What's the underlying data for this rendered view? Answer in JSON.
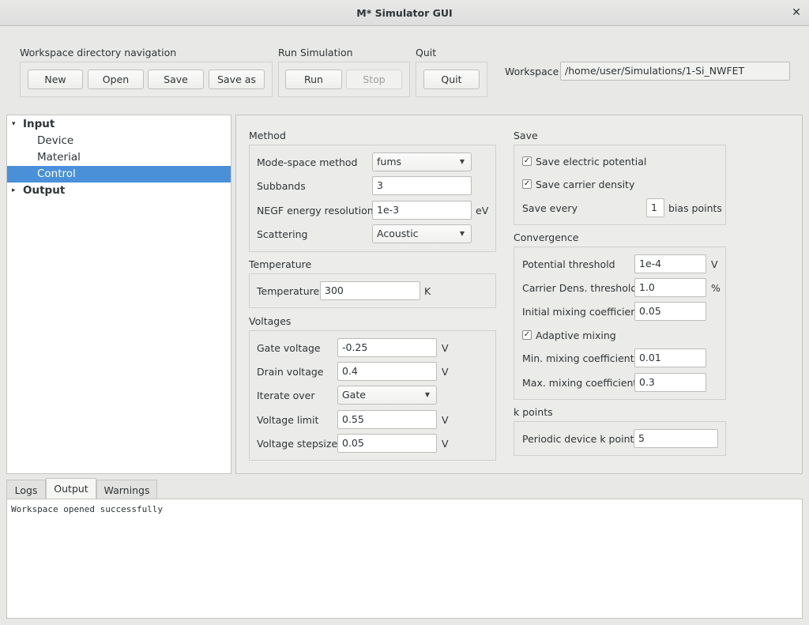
{
  "window": {
    "title": "M* Simulator GUI",
    "close_glyph": "✕"
  },
  "toolbar": {
    "workspace_nav": {
      "label": "Workspace directory navigation",
      "new": "New",
      "open": "Open",
      "save": "Save",
      "save_as": "Save as"
    },
    "run": {
      "label": "Run Simulation",
      "run": "Run",
      "stop": "Stop"
    },
    "quit": {
      "label": "Quit",
      "quit": "Quit"
    },
    "workspace": {
      "label": "Workspace",
      "path": "/home/user/Simulations/1-Si_NWFET"
    }
  },
  "tree": {
    "input": {
      "label": "Input",
      "expander": "▾"
    },
    "children": [
      "Device",
      "Material",
      "Control"
    ],
    "output": {
      "label": "Output",
      "expander": "▸"
    }
  },
  "method": {
    "title": "Method",
    "mode_space": {
      "label": "Mode-space method",
      "value": "fums"
    },
    "subbands": {
      "label": "Subbands",
      "value": "3"
    },
    "negf": {
      "label": "NEGF energy resolution",
      "value": "1e-3",
      "unit": "eV"
    },
    "scattering": {
      "label": "Scattering",
      "value": "Acoustic"
    }
  },
  "temperature": {
    "title": "Temperature",
    "label": "Temperature",
    "value": "300",
    "unit": "K"
  },
  "voltages": {
    "title": "Voltages",
    "gate": {
      "label": "Gate voltage",
      "value": "-0.25",
      "unit": "V"
    },
    "drain": {
      "label": "Drain voltage",
      "value": "0.4",
      "unit": "V"
    },
    "iterate": {
      "label": "Iterate over",
      "value": "Gate"
    },
    "limit": {
      "label": "Voltage limit",
      "value": "0.55",
      "unit": "V"
    },
    "stepsize": {
      "label": "Voltage stepsize",
      "value": "0.05",
      "unit": "V"
    }
  },
  "save": {
    "title": "Save",
    "electric_potential": {
      "label": "Save electric potential",
      "checked": true
    },
    "carrier_density": {
      "label": "Save carrier density",
      "checked": true
    },
    "every": {
      "label": "Save every",
      "value": "1",
      "unit": "bias points"
    }
  },
  "convergence": {
    "title": "Convergence",
    "potential": {
      "label": "Potential threshold",
      "value": "1e-4",
      "unit": "V"
    },
    "carrier": {
      "label": "Carrier Dens. threshold",
      "value": "1.0",
      "unit": "%"
    },
    "initial_mixing": {
      "label": "Initial mixing coefficient",
      "value": "0.05"
    },
    "adaptive": {
      "label": "Adaptive mixing",
      "checked": true
    },
    "min_mixing": {
      "label": "Min. mixing coefficient",
      "value": "0.01"
    },
    "max_mixing": {
      "label": "Max. mixing coefficient",
      "value": "0.3"
    }
  },
  "kpoints": {
    "title": "k points",
    "label": "Periodic device k points",
    "value": "5"
  },
  "bottom_tabs": {
    "logs": "Logs",
    "output": "Output",
    "warnings": "Warnings",
    "active": "Output"
  },
  "log_text": "Workspace opened successfully",
  "icons": {
    "check": "✓",
    "dropdown": "▼"
  },
  "colors": {
    "selection": "#4a90d9",
    "background": "#e8e8e7"
  }
}
